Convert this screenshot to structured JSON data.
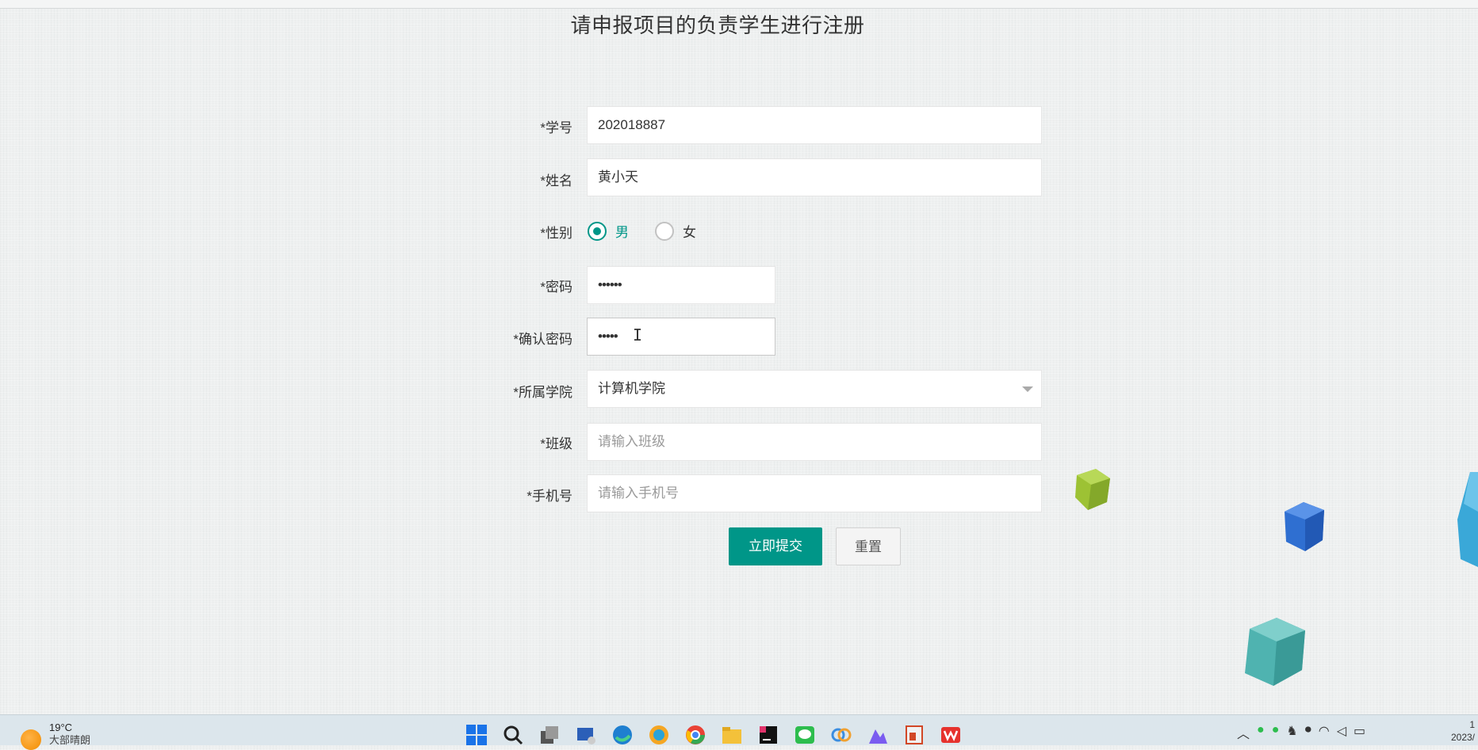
{
  "page": {
    "title": "请申报项目的负责学生进行注册"
  },
  "form": {
    "student_id": {
      "label": "*学号",
      "value": "202018887"
    },
    "name": {
      "label": "*姓名",
      "value": "黄小天"
    },
    "gender": {
      "label": "*性别",
      "options": [
        "男",
        "女"
      ],
      "selected": "男"
    },
    "password": {
      "label": "*密码",
      "value": "••••••"
    },
    "confirm_password": {
      "label": "*确认密码",
      "value": "•••••"
    },
    "college": {
      "label": "*所属学院",
      "value": "计算机学院"
    },
    "class": {
      "label": "*班级",
      "placeholder": "请输入班级"
    },
    "phone": {
      "label": "*手机号",
      "placeholder": "请输入手机号"
    },
    "submit_label": "立即提交",
    "reset_label": "重置"
  },
  "colors": {
    "accent": "#009688",
    "background": "#eef0f0"
  },
  "taskbar": {
    "weather": {
      "temp": "19°C",
      "desc": "大部晴朗",
      "icon": "partly-sunny-icon"
    },
    "apps": [
      {
        "name": "start-icon"
      },
      {
        "name": "search-icon"
      },
      {
        "name": "task-view-icon"
      },
      {
        "name": "network-app-icon"
      },
      {
        "name": "edge-icon"
      },
      {
        "name": "browser-e-icon"
      },
      {
        "name": "chrome-icon"
      },
      {
        "name": "file-explorer-icon"
      },
      {
        "name": "intellij-icon"
      },
      {
        "name": "wechat-icon"
      },
      {
        "name": "app-shape-icon"
      },
      {
        "name": "mountain-app-icon"
      },
      {
        "name": "powerpoint-icon"
      },
      {
        "name": "wps-icon"
      }
    ],
    "clock": {
      "time": "1",
      "date": "2023/"
    }
  }
}
